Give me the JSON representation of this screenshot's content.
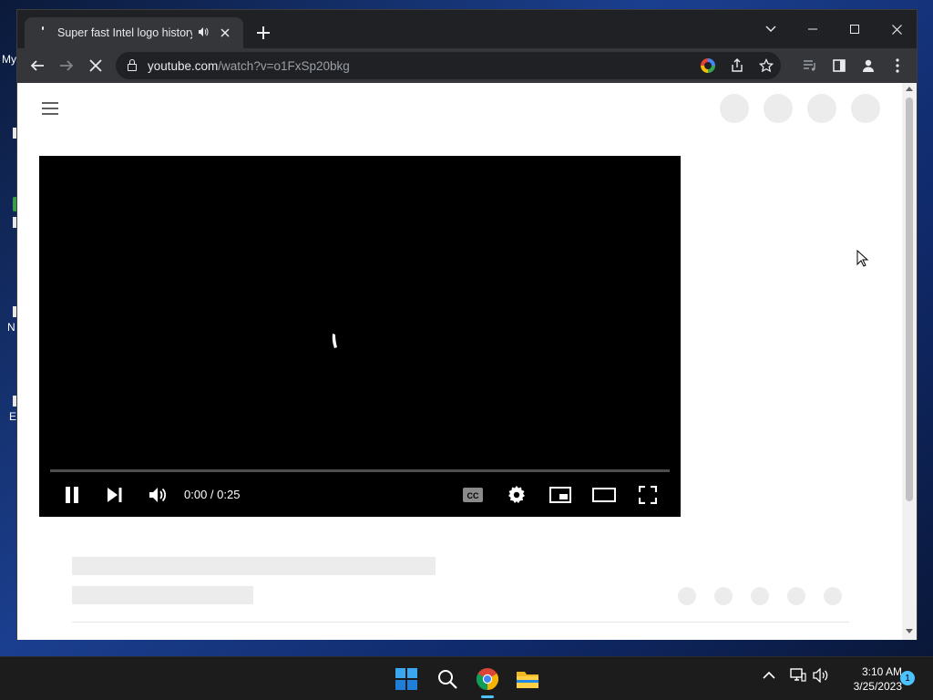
{
  "desktop": {
    "labels": [
      "My",
      "N",
      "E"
    ]
  },
  "browser": {
    "tab": {
      "title": "Super fast Intel logo history",
      "audio_icon": "speaker-icon",
      "close_icon": "close-icon"
    },
    "new_tab_icon": "plus-icon",
    "window_controls": [
      "tab-search-icon",
      "minimize-icon",
      "maximize-icon",
      "close-icon"
    ],
    "toolbar": {
      "back_icon": "back-arrow-icon",
      "forward_icon": "forward-arrow-icon",
      "reload_state": "loading",
      "url_host": "youtube.com",
      "url_path": "/watch?v=o1FxSp20bkg",
      "omnibox_icons": [
        "google-lens-icon",
        "share-icon",
        "bookmark-star-icon"
      ],
      "right_icons": [
        "media-controls-icon",
        "side-panel-icon",
        "profile-icon",
        "menu-icon"
      ]
    }
  },
  "youtube": {
    "menu_icon": "hamburger-menu-icon",
    "player": {
      "state": "loading",
      "time_display": "0:00 / 0:25",
      "controls": [
        "pause-icon",
        "next-icon",
        "volume-icon",
        "captions-icon",
        "settings-icon",
        "miniplayer-icon",
        "theater-mode-icon",
        "fullscreen-icon"
      ]
    }
  },
  "taskbar": {
    "apps": [
      "windows-start-icon",
      "search-icon",
      "chrome-icon",
      "file-explorer-icon"
    ],
    "active_app": "chrome-icon",
    "tray": [
      "chevron-up-icon",
      "network-icon",
      "volume-icon"
    ],
    "time": "3:10 AM",
    "date": "3/25/2023",
    "notification_count": "1"
  },
  "colors": {
    "browser_frame": "#202124",
    "toolbar": "#35363a",
    "skeleton": "#ececec",
    "player_bg": "#000000",
    "taskbar": "#1c1c1c",
    "accent": "#4cc2ff"
  }
}
